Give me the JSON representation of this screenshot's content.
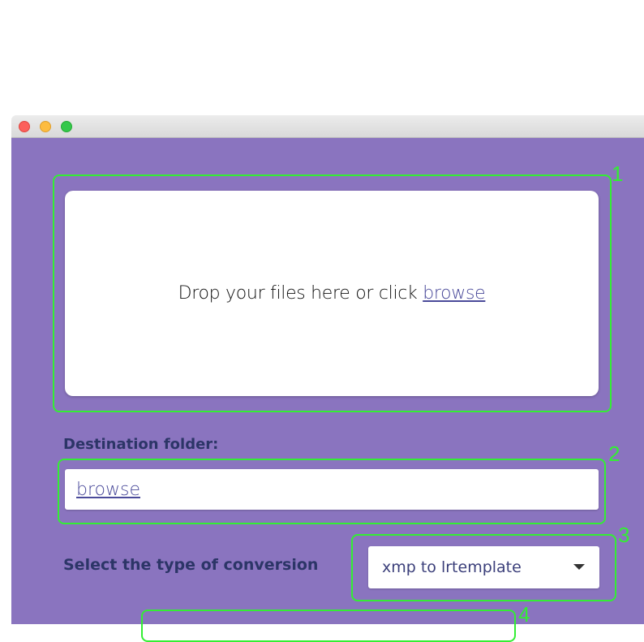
{
  "dropzone": {
    "prompt": "Drop your files here or click ",
    "browse_link": "browse"
  },
  "destination": {
    "label": "Destination folder:",
    "browse_link": "browse"
  },
  "conversion": {
    "label": "Select the type of conversion",
    "selected": "xmp to lrtemplate"
  },
  "annotations": [
    "1",
    "2",
    "3",
    "4"
  ],
  "colors": {
    "background": "#8a74bf",
    "highlight": "#33ee33",
    "label_text": "#2c3567",
    "link": "#4a4a9a"
  },
  "icons": {
    "dropdown": "chevron-down-icon"
  }
}
